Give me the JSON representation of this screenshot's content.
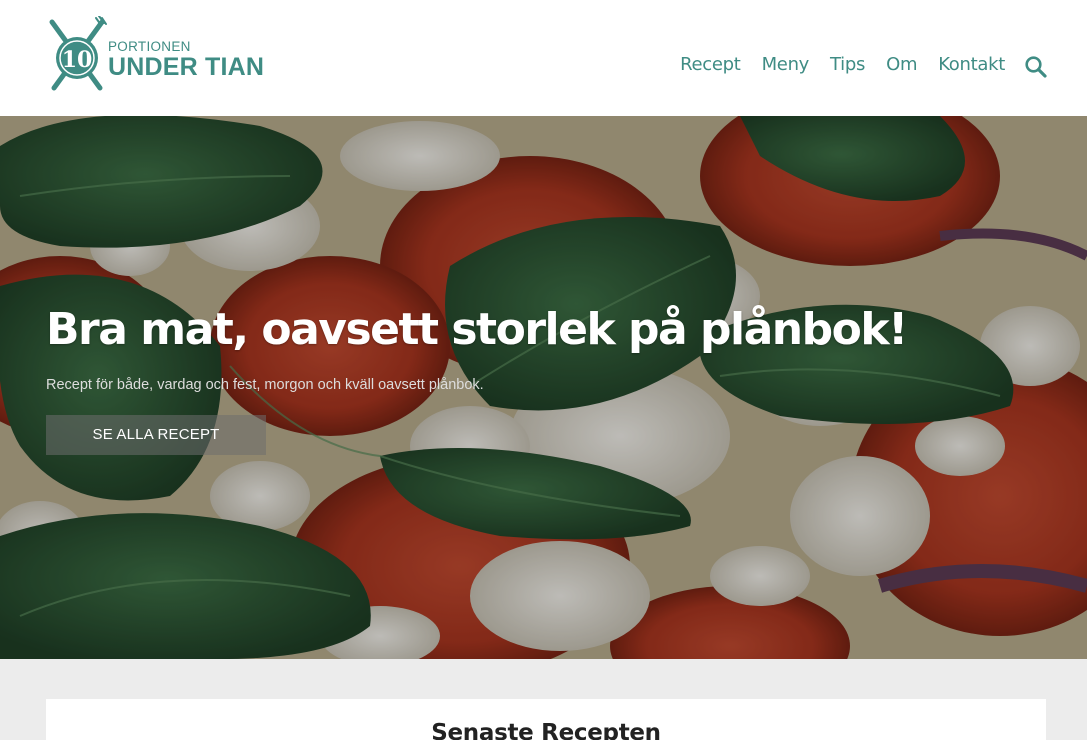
{
  "brand": {
    "badge_number": "10",
    "small_text": "PORTIONEN",
    "big_text": "UNDER TIAN",
    "color": "#3f8c84"
  },
  "nav": {
    "items": [
      "Recept",
      "Meny",
      "Tips",
      "Om",
      "Kontakt"
    ],
    "search_icon": "search-icon"
  },
  "hero": {
    "title": "Bra mat, oavsett storlek på plånbok!",
    "subtitle": "Recept för både, vardag och fest, morgon och kväll oavsett plånbok.",
    "button_label": "SE ALLA RECEPT",
    "image": "pizza-with-tomato-feta-spinach"
  },
  "section": {
    "title": "Senaste Recepten"
  }
}
